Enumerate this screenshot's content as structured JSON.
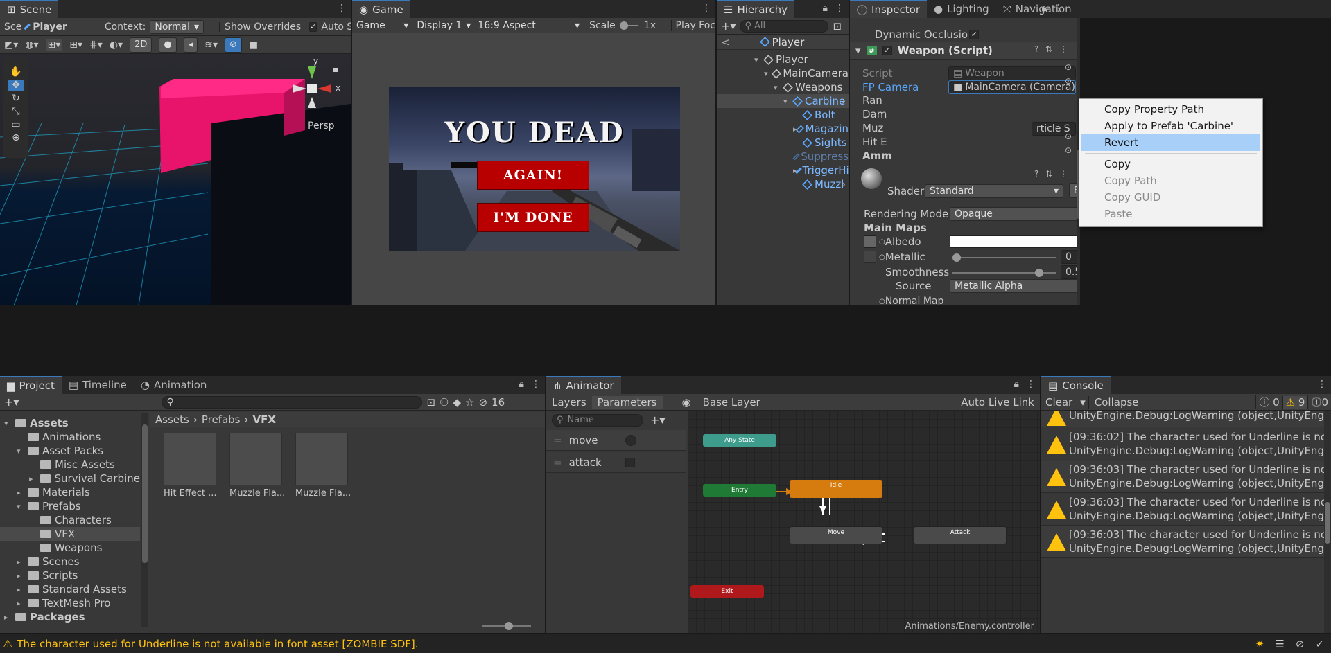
{
  "scene": {
    "tab": "Scene",
    "breadcrumb_short": "Sce",
    "breadcrumb_obj": "Player",
    "context_label": "Context:",
    "context_value": "Normal",
    "show_overrides": "Show Overrides",
    "auto_save": "Auto Save",
    "btn_2d": "2D",
    "persp": "Persp",
    "axis_y": "y",
    "axis_x": "x"
  },
  "game": {
    "tab": "Game",
    "mode": "Game",
    "display": "Display 1",
    "aspect": "16:9 Aspect",
    "scale_label": "Scale",
    "scale_value": "1x",
    "play_focused": "Play Foc",
    "title": "YOU DEAD",
    "btn_again": "AGAIN!",
    "btn_done": "I'M DONE"
  },
  "hierarchy": {
    "tab": "Hierarchy",
    "search_placeholder": "All",
    "header": "Player",
    "items": [
      {
        "label": "Player",
        "depth": 0,
        "type": "white"
      },
      {
        "label": "MainCamera",
        "depth": 1,
        "type": "white"
      },
      {
        "label": "Weapons",
        "depth": 2,
        "type": "white"
      },
      {
        "label": "Carbine",
        "depth": 3,
        "type": "blue"
      },
      {
        "label": "Bolt",
        "depth": 4,
        "type": "blue"
      },
      {
        "label": "Magazin",
        "depth": 4,
        "type": "blue"
      },
      {
        "label": "Sights",
        "depth": 4,
        "type": "blue"
      },
      {
        "label": "Suppress",
        "depth": 4,
        "type": "dim"
      },
      {
        "label": "TriggerHi",
        "depth": 4,
        "type": "blue"
      },
      {
        "label": "Muzzl",
        "depth": 4,
        "type": "blue"
      }
    ]
  },
  "inspector": {
    "tabs": [
      "Inspector",
      "Lighting",
      "Navigation"
    ],
    "dynamic_occlusion": "Dynamic Occlusio",
    "component_title": "Weapon (Script)",
    "script_label": "Script",
    "script_value": "Weapon",
    "fp_camera_label": "FP Camera",
    "fp_camera_value": "MainCamera (Camera)",
    "partial_labels": [
      "Ran",
      "Dam",
      "Muz",
      "Hit E",
      "Amm"
    ],
    "partial_value": "rticle S",
    "shader_label": "Shader",
    "shader_value": "Standard",
    "edit_btn": "Edit...",
    "rendering_mode_label": "Rendering Mode",
    "rendering_mode_value": "Opaque",
    "main_maps": "Main Maps",
    "albedo": "Albedo",
    "metallic": "Metallic",
    "metallic_value": "0",
    "metallic_level": 0,
    "smoothness": "Smoothness",
    "smoothness_value": "0.5",
    "smoothness_level": 0.5,
    "source_label": "Source",
    "source_value": "Metallic Alpha",
    "normal_map": "Normal Map"
  },
  "context_menu": {
    "items": [
      {
        "label": "Copy Property Path",
        "state": "normal"
      },
      {
        "label": "Apply to Prefab 'Carbine'",
        "state": "normal"
      },
      {
        "label": "Revert",
        "state": "selected"
      },
      {
        "label": "Copy",
        "state": "normal"
      },
      {
        "label": "Copy Path",
        "state": "disabled"
      },
      {
        "label": "Copy GUID",
        "state": "disabled"
      },
      {
        "label": "Paste",
        "state": "disabled"
      }
    ]
  },
  "project": {
    "tabs": [
      "Project",
      "Timeline",
      "Animation"
    ],
    "hidden_count": "16",
    "breadcrumb": [
      "Assets",
      "Prefabs",
      "VFX"
    ],
    "tree": [
      {
        "label": "Assets",
        "depth": 0,
        "bold": true
      },
      {
        "label": "Animations",
        "depth": 1
      },
      {
        "label": "Asset Packs",
        "depth": 1
      },
      {
        "label": "Misc Assets",
        "depth": 2
      },
      {
        "label": "Survival Carbine",
        "depth": 2
      },
      {
        "label": "Materials",
        "depth": 1
      },
      {
        "label": "Prefabs",
        "depth": 1
      },
      {
        "label": "Characters",
        "depth": 2
      },
      {
        "label": "VFX",
        "depth": 2
      },
      {
        "label": "Weapons",
        "depth": 2
      },
      {
        "label": "Scenes",
        "depth": 1
      },
      {
        "label": "Scripts",
        "depth": 1
      },
      {
        "label": "Standard Assets",
        "depth": 1
      },
      {
        "label": "TextMesh Pro",
        "depth": 1
      },
      {
        "label": "Packages",
        "depth": 0,
        "bold": true
      }
    ],
    "assets": [
      "Hit Effect ...",
      "Muzzle Fla...",
      "Muzzle Fla..."
    ]
  },
  "animator": {
    "tab": "Animator",
    "tab_layers": "Layers",
    "tab_params": "Parameters",
    "base_layer": "Base Layer",
    "auto_live_link": "Auto Live Link",
    "name_placeholder": "Name",
    "params": [
      {
        "label": "move",
        "kind": "trigger"
      },
      {
        "label": "attack",
        "kind": "bool"
      }
    ],
    "nodes": {
      "any_state": "Any State",
      "entry": "Entry",
      "idle": "Idle",
      "move": "Move",
      "attack": "Attack",
      "exit": "Exit"
    },
    "footer": "Animations/Enemy.controller"
  },
  "console": {
    "tab": "Console",
    "clear": "Clear",
    "collapse": "Collapse",
    "info_count": "0",
    "warn_count": "9",
    "error_count": "0",
    "partial_top": "UnityEngine.Debug:LogWarning (object,UnityEng",
    "entries": [
      {
        "line1": "[09:36:02] The character used for Underline is no",
        "line2": "UnityEngine.Debug:LogWarning (object,UnityEng"
      },
      {
        "line1": "[09:36:03] The character used for Underline is no",
        "line2": "UnityEngine.Debug:LogWarning (object,UnityEng"
      },
      {
        "line1": "[09:36:03] The character used for Underline is no",
        "line2": "UnityEngine.Debug:LogWarning (object,UnityEng"
      },
      {
        "line1": "[09:36:03] The character used for Underline is no",
        "line2": "UnityEngine.Debug:LogWarning (object,UnityEng"
      }
    ]
  },
  "status": {
    "message": "The character used for Underline is not available in font asset [ZOMBIE SDF]."
  },
  "colors": {
    "accent": "#3a79bb",
    "warning": "#ffc20e",
    "menu_selected": "#4d8fd8",
    "game_button": "#b80000",
    "idle_node": "#d67c0f",
    "entry_node": "#1f7a35",
    "exit_node": "#b0191c",
    "any_state_node": "#3d9c8c"
  }
}
